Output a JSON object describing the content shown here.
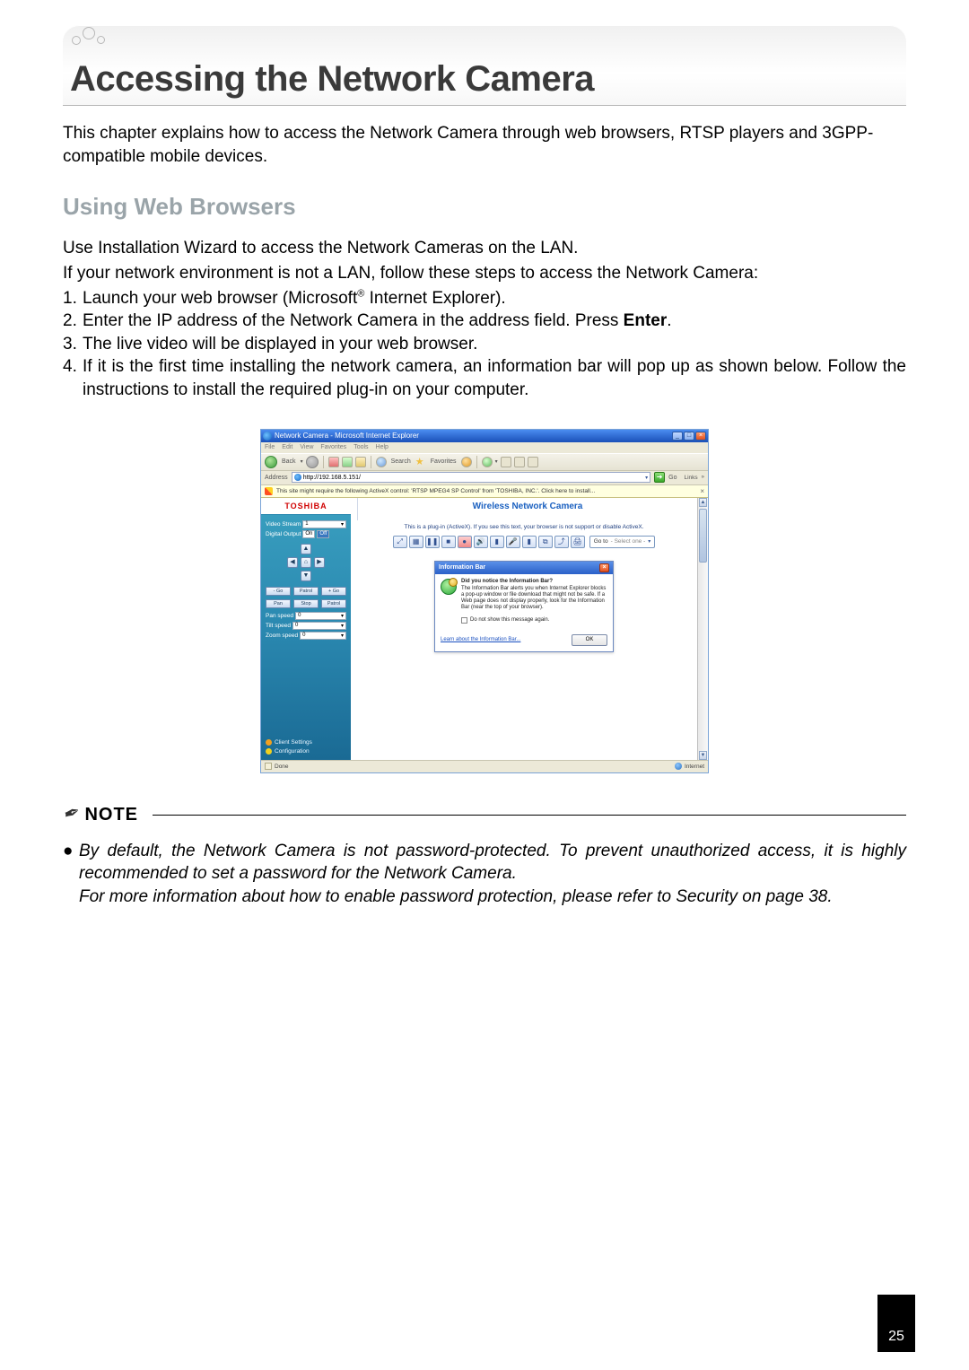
{
  "page": {
    "chapter_title": "Accessing the Network Camera",
    "intro": "This chapter explains how to access the Network Camera through web browsers, RTSP players and 3GPP-compatible mobile devices.",
    "subhead": "Using Web Browsers",
    "para1": "Use Installation Wizard to access the Network Cameras on the LAN.",
    "para2": "If your network environment is not a LAN, follow these steps to access the Network Camera:",
    "steps": [
      "Launch your web browser (Microsoft® Internet Explorer).",
      "Enter the IP address of the Network Camera in the address field. Press Enter.",
      "The live video will be displayed in your web browser.",
      "If it is the first time installing the network camera, an information bar will pop up as shown below. Follow the instructions to install the required plug-in on your computer."
    ],
    "number": "25"
  },
  "note": {
    "label": "NOTE",
    "bullet_text": "By default, the Network Camera is not password-protected. To prevent unauthorized access, it is highly recommended to set a password for the Network Camera.",
    "more": "For more information about how to enable password protection, please refer to Security on page 38."
  },
  "ie": {
    "title": "Network Camera - Microsoft Internet Explorer",
    "menu": [
      "File",
      "Edit",
      "View",
      "Favorites",
      "Tools",
      "Help"
    ],
    "toolbar": {
      "back": "Back",
      "search": "Search",
      "favorites": "Favorites"
    },
    "address_label": "Address",
    "address_value": "http://192.168.5.151/",
    "go": "Go",
    "links": "Links",
    "infobar": "This site might require the following ActiveX control: 'RTSP MPEG4 SP Control' from 'TOSHIBA, INC.'. Click here to install...",
    "status_done": "Done",
    "status_zone": "Internet"
  },
  "cam": {
    "brand": "TOSHIBA",
    "title": "Wireless Network Camera",
    "sidebar": {
      "video_stream_label": "Video Stream",
      "video_stream_value": "1",
      "digital_output_label": "Digital Output",
      "digital_output_on": "On",
      "digital_output_off": "Off",
      "row1": [
        "- Go",
        "Patrol",
        "+ Go"
      ],
      "row2": [
        "Pan",
        "Stop",
        "Patrol"
      ],
      "pan_speed_label": "Pan speed",
      "pan_speed_value": "0",
      "tilt_speed_label": "Tilt speed",
      "tilt_speed_value": "0",
      "zoom_speed_label": "Zoom speed",
      "zoom_speed_value": "0",
      "link1": "Client Settings",
      "link2": "Configuration"
    },
    "plugin_msg": "This is a plug-in (ActiveX). If you see this text, your browser is not support or disable ActiveX.",
    "goto_label": "Go to",
    "goto_value": "- Select one -",
    "dialog": {
      "title": "Information Bar",
      "heading": "Did you notice the Information Bar?",
      "body": "The Information Bar alerts you when Internet Explorer blocks a pop-up window or file download that might not be safe. If a Web page does not display properly, look for the Information Bar (near the top of your browser).",
      "checkbox": "Do not show this message again.",
      "learn": "Learn about the Information Bar...",
      "ok": "OK"
    }
  }
}
